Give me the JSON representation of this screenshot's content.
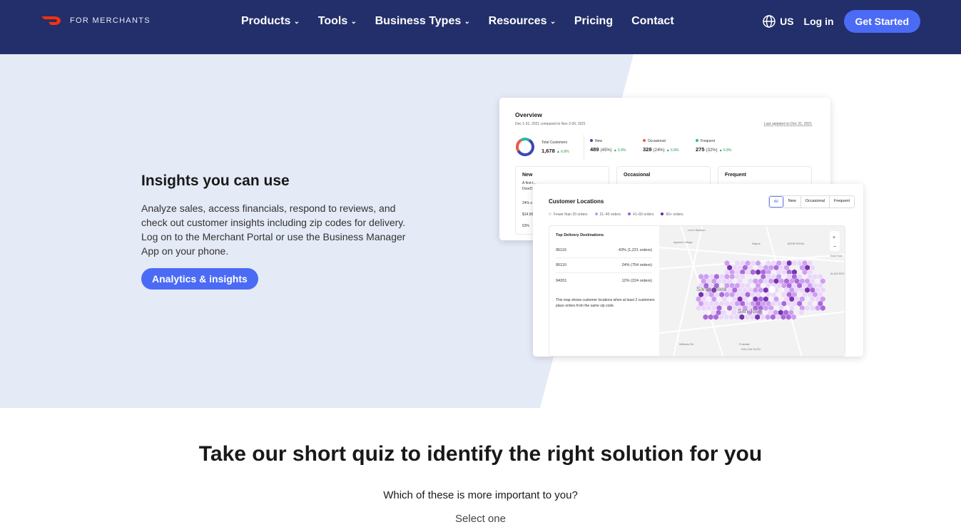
{
  "nav": {
    "brand": "FOR MERCHANTS",
    "items": [
      "Products",
      "Tools",
      "Business Types",
      "Resources",
      "Pricing",
      "Contact"
    ],
    "region": "US",
    "login": "Log in",
    "cta": "Get Started"
  },
  "hero": {
    "title": "Insights you can use",
    "description": "Analyze sales, access financials, respond to reviews, and check out customer insights including zip codes for delivery. Log on to the Merchant Portal or use the Business Manager App on your phone.",
    "button": "Analytics & insights"
  },
  "overview": {
    "title": "Overview",
    "date_range": "Dec 1-31, 2021 compared to Nov 3-30, 2021",
    "updated": "Last updated on Dec 31, 2021",
    "total_label": "Total Customers",
    "total": "1,678",
    "total_change": "▲ 6.8%",
    "segments": [
      {
        "name": "New",
        "value": "489",
        "pct": "(45%)",
        "change": "▲ 6.8%",
        "color": "#3b46b8"
      },
      {
        "name": "Occasional",
        "value": "328",
        "pct": "(24%)",
        "change": "▲ 6.8%",
        "color": "#ea5a44"
      },
      {
        "name": "Frequent",
        "value": "275",
        "pct": "(32%)",
        "change": "▲ 6.8%",
        "color": "#2bb5a5"
      }
    ],
    "cards": [
      "New",
      "Occasional",
      "Frequent"
    ],
    "new_card_lines": [
      "A first-t...",
      "DoorD...",
      "24% o",
      "$14.50",
      "63%"
    ]
  },
  "locations": {
    "title": "Customer Locations",
    "filters": [
      "All",
      "New",
      "Occasional",
      "Frequent"
    ],
    "legend": [
      {
        "label": "Fewer than 20 orders",
        "color": "#ead6fb"
      },
      {
        "label": "21–40 orders",
        "color": "#c996f0"
      },
      {
        "label": "41–60 orders",
        "color": "#a25bd8"
      },
      {
        "label": "60+ orders",
        "color": "#6a1fa8"
      }
    ],
    "top_title": "Top Delivery Destinations",
    "rows": [
      {
        "zip": "95116",
        "value": "43% (1,221 orders)"
      },
      {
        "zip": "95110",
        "value": "24% (754 orders)"
      },
      {
        "zip": "94201",
        "value": "12% (224 orders)"
      }
    ],
    "note": "This map shows customer locations when at least 2 customers place orders from the same zip code.",
    "map_labels": [
      "Levi's Stadium",
      "Agnew's Village",
      "Wayne",
      "BERRYESSA",
      "East Foot",
      "ALUM ROCK",
      "Santa Clara",
      "San Jose",
      "Williams Rd",
      "Fruitdale",
      "WILLOW GLEN"
    ]
  },
  "quiz": {
    "title": "Take our short quiz to identify the right solution for you",
    "question": "Which of these is more important to you?",
    "hint": "Select one"
  }
}
